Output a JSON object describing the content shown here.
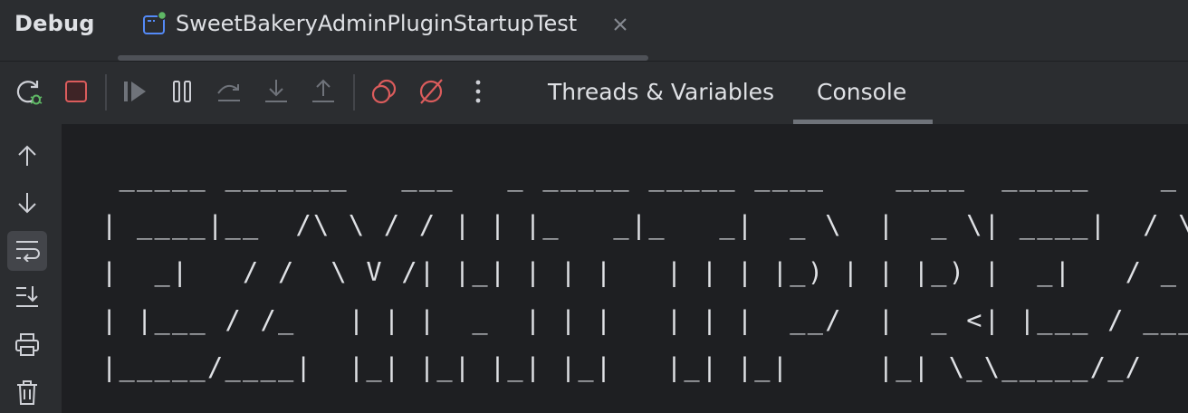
{
  "panel": {
    "title": "Debug"
  },
  "session_tab": {
    "label": "SweetBakeryAdminPluginStartupTest",
    "icon": "run-config-icon",
    "status_color": "#5fb865",
    "close_icon": "close-icon"
  },
  "toolbar": {
    "buttons": [
      {
        "name": "rerun-debug-button",
        "icon": "rerun-debug-icon"
      },
      {
        "name": "stop-button",
        "icon": "stop-icon",
        "color": "#db5c5c"
      },
      {
        "name": "resume-button",
        "icon": "resume-icon",
        "enabled": false
      },
      {
        "name": "pause-button",
        "icon": "pause-icon"
      },
      {
        "name": "step-over-button",
        "icon": "step-over-icon",
        "enabled": false
      },
      {
        "name": "step-into-button",
        "icon": "step-into-icon",
        "enabled": false
      },
      {
        "name": "step-out-button",
        "icon": "step-out-icon",
        "enabled": false
      },
      {
        "name": "view-breakpoints-button",
        "icon": "view-breakpoints-icon",
        "color": "#db5c5c"
      },
      {
        "name": "mute-breakpoints-button",
        "icon": "mute-breakpoints-icon",
        "color": "#db5c5c"
      },
      {
        "name": "more-button",
        "icon": "more-vertical-icon"
      }
    ],
    "tabs": [
      {
        "label": "Threads & Variables",
        "active": false
      },
      {
        "label": "Console",
        "active": true
      }
    ]
  },
  "gutter": {
    "buttons": [
      {
        "name": "scroll-up-button",
        "icon": "arrow-up-icon"
      },
      {
        "name": "scroll-down-button",
        "icon": "arrow-down-icon"
      },
      {
        "name": "soft-wrap-button",
        "icon": "soft-wrap-icon",
        "selected": true
      },
      {
        "name": "scroll-to-end-button",
        "icon": "scroll-to-end-icon"
      },
      {
        "name": "print-button",
        "icon": "print-icon"
      },
      {
        "name": "clear-all-button",
        "icon": "trash-icon"
      }
    ]
  },
  "console": {
    "lines": [
      " _____ _______   ___   _ _____ _____ ____    ____  _____    _    ______  __",
      "| ____|__  /\\ \\ / / | | |_   _|_   _|  _ \\  |  _ \\| ____|  / \\  |  _ \\ \\ / /",
      "|  _|   / /  \\ V /| |_| | | |   | | | |_) | | |_) |  _|   / _ \\ | | | \\ V /",
      "| |___ / /_   | | |  _  | | |   | | |  __/  |  _ <| |___ / ___ \\| |_| || |",
      "|_____/____|  |_| |_| |_| |_|   |_| |_|     |_| \\_\\_____/_/   \\_\\____/ |_|"
    ]
  },
  "colors": {
    "panel_bg": "#2b2d30",
    "editor_bg": "#1e1f22",
    "text": "#dfe1e5",
    "icon": "#ced0d6",
    "icon_disabled": "#6f737a",
    "accent_red": "#db5c5c",
    "accent_blue": "#548af7",
    "accent_green": "#5fb865"
  }
}
